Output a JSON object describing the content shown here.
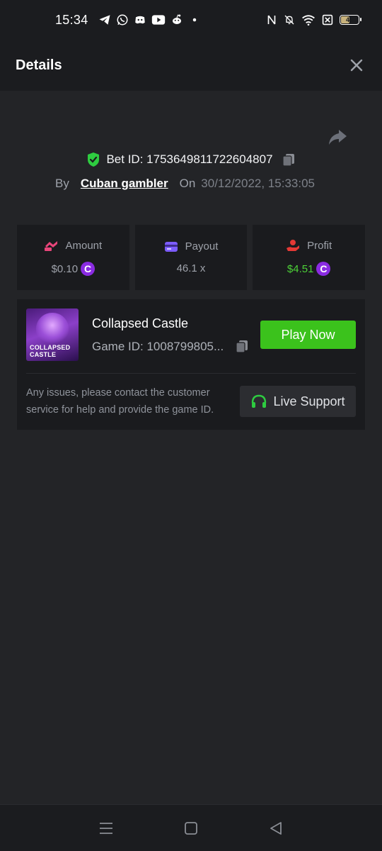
{
  "status_bar": {
    "time": "15:34",
    "battery": "46"
  },
  "header": {
    "title": "Details"
  },
  "bet": {
    "id_text": "Bet ID: 1753649811722604807",
    "by_label": "By",
    "user": "Cuban gambler",
    "on_label": "On",
    "datetime": "30/12/2022, 15:33:05"
  },
  "stats": [
    {
      "label": "Amount",
      "value": "$0.10",
      "coin": "C",
      "color": "#e8457a"
    },
    {
      "label": "Payout",
      "value": "46.1 x",
      "color": "#7c5cff"
    },
    {
      "label": "Profit",
      "value": "$4.51",
      "coin": "C",
      "color": "#e53935"
    }
  ],
  "game": {
    "thumb_line1": "COLLAPSED",
    "thumb_line2": "CASTLE",
    "name": "Collapsed Castle",
    "id_text": "Game ID: 1008799805...",
    "play_label": "Play Now",
    "issues_text": "Any issues, please contact the customer service for help and provide the game ID.",
    "support_label": "Live Support"
  },
  "colors": {
    "accent_green": "#3bc21c",
    "profit_green": "#4cd137",
    "coin_purple": "#8a2be2",
    "verified_green": "#2ecc40"
  }
}
